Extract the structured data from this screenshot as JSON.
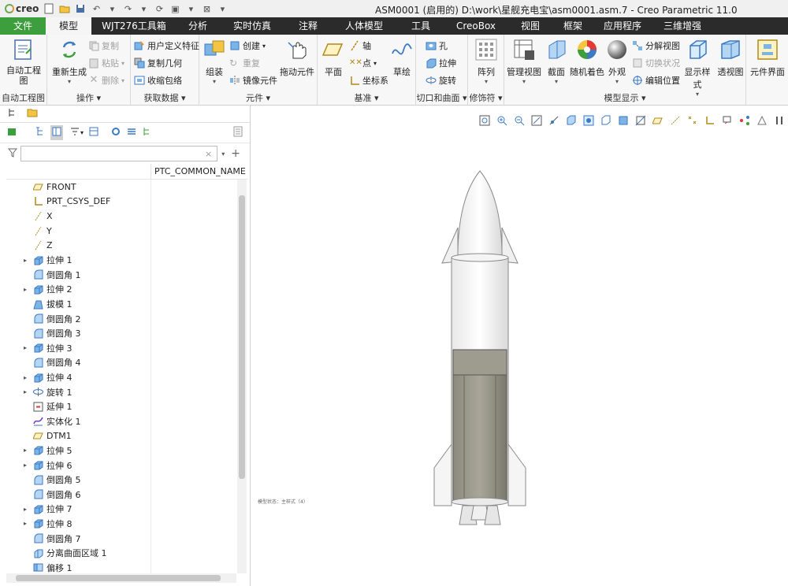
{
  "app": {
    "logo": "creo",
    "title": "ASM0001 (启用的) D:\\work\\星舰充电宝\\asm0001.asm.7 - Creo Parametric 11.0"
  },
  "menu_tabs": [
    "文件",
    "模型",
    "WJT276工具箱",
    "分析",
    "实时仿真",
    "注释",
    "人体模型",
    "工具",
    "CreoBox",
    "视图",
    "框架",
    "应用程序",
    "三维增强"
  ],
  "active_tab": "模型",
  "ribbon": {
    "auto_drawing": {
      "button": "自动工程图",
      "group": "自动工程图"
    },
    "operations": {
      "regenerate": "重新生成",
      "copy": "复制",
      "paste": "粘贴",
      "delete": "删除",
      "group": "操作"
    },
    "get_data": {
      "udf": "用户定义特征",
      "copy_geom": "复制几何",
      "shrinkwrap": "收缩包络",
      "group": "获取数据"
    },
    "component": {
      "assemble": "组装",
      "create": "创建",
      "repeat": "重复",
      "mirror": "镜像元件",
      "drag": "拖动元件",
      "group": "元件"
    },
    "datum": {
      "plane": "平面",
      "axis": "轴",
      "point": "点",
      "csys": "坐标系",
      "sketch": "草绘",
      "group": "基准"
    },
    "cut_surface": {
      "hole": "孔",
      "extrude": "拉伸",
      "revolve": "旋转",
      "group": "切口和曲面"
    },
    "modifiers": {
      "pattern": "阵列",
      "group": "修饰符"
    },
    "model_display": {
      "manage_views": "管理视图",
      "section": "截面",
      "random_color": "随机着色",
      "appearance": "外观",
      "explode": "分解视图",
      "toggle_state": "切换状况",
      "edit_position": "编辑位置",
      "display_style": "显示样式",
      "perspective": "透视图",
      "group": "模型显示"
    },
    "ui": {
      "element_ui": "元件界面"
    }
  },
  "tree": {
    "filter_placeholder": "",
    "column_header": "PTC_COMMON_NAME",
    "rows": [
      {
        "label": "FRONT",
        "icon": "plane",
        "expand": false
      },
      {
        "label": "PRT_CSYS_DEF",
        "icon": "csys",
        "expand": false
      },
      {
        "label": "X",
        "icon": "axis",
        "expand": false
      },
      {
        "label": "Y",
        "icon": "axis",
        "expand": false
      },
      {
        "label": "Z",
        "icon": "axis",
        "expand": false
      },
      {
        "label": "拉伸 1",
        "icon": "extrude",
        "expand": true
      },
      {
        "label": "倒圆角 1",
        "icon": "round",
        "expand": false
      },
      {
        "label": "拉伸 2",
        "icon": "extrude",
        "expand": true
      },
      {
        "label": "拔模 1",
        "icon": "draft",
        "expand": false
      },
      {
        "label": "倒圆角 2",
        "icon": "round",
        "expand": false
      },
      {
        "label": "倒圆角 3",
        "icon": "round",
        "expand": false
      },
      {
        "label": "拉伸 3",
        "icon": "extrude",
        "expand": true
      },
      {
        "label": "倒圆角 4",
        "icon": "round",
        "expand": false
      },
      {
        "label": "拉伸 4",
        "icon": "extrude",
        "expand": true
      },
      {
        "label": "旋转 1",
        "icon": "revolve",
        "expand": true
      },
      {
        "label": "延伸 1",
        "icon": "extend",
        "expand": false
      },
      {
        "label": "实体化 1",
        "icon": "solidify",
        "expand": false
      },
      {
        "label": "DTM1",
        "icon": "plane",
        "expand": false
      },
      {
        "label": "拉伸 5",
        "icon": "extrude",
        "expand": true
      },
      {
        "label": "拉伸 6",
        "icon": "extrude",
        "expand": true
      },
      {
        "label": "倒圆角 5",
        "icon": "round",
        "expand": false
      },
      {
        "label": "倒圆角 6",
        "icon": "round",
        "expand": false
      },
      {
        "label": "拉伸 7",
        "icon": "extrude",
        "expand": true
      },
      {
        "label": "拉伸 8",
        "icon": "extrude",
        "expand": true
      },
      {
        "label": "倒圆角 7",
        "icon": "round",
        "expand": false
      },
      {
        "label": "分离曲面区域 1",
        "icon": "split",
        "expand": false
      },
      {
        "label": "偏移 1",
        "icon": "offset",
        "expand": false
      }
    ]
  },
  "graphics": {
    "status_note": "模型状态：主样式（4）"
  }
}
